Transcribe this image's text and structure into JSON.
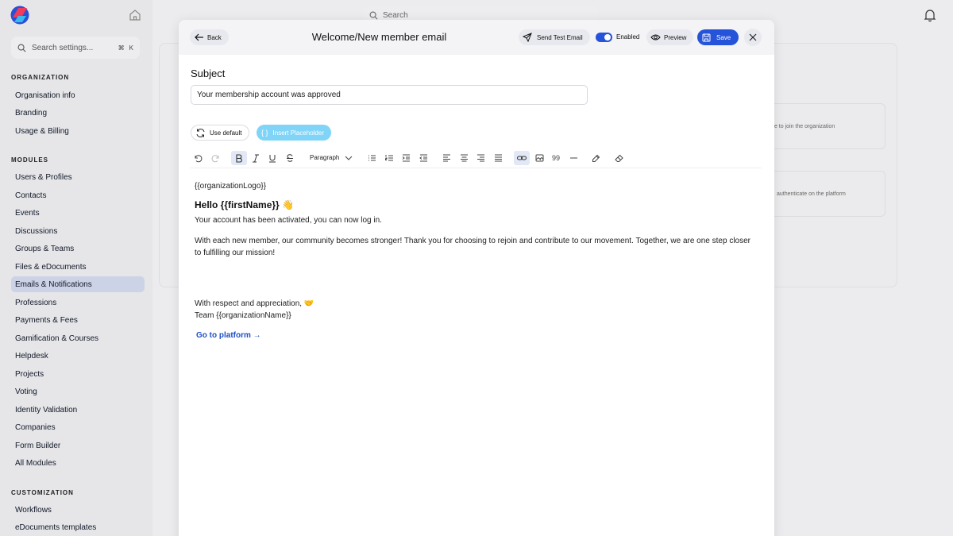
{
  "app": {
    "settings_search": {
      "placeholder": "Search settings...",
      "shortcut_cmd": "⌘",
      "shortcut_key": "K"
    },
    "topbar_search": {
      "placeholder": "Search"
    },
    "sidebar": {
      "sections": [
        {
          "title": "ORGANIZATION",
          "items": [
            "Organisation info",
            "Branding",
            "Usage & Billing"
          ]
        },
        {
          "title": "MODULES",
          "items": [
            "Users & Profiles",
            "Contacts",
            "Events",
            "Discussions",
            "Groups & Teams",
            "Files & eDocuments",
            "Emails & Notifications",
            "Professions",
            "Payments & Fees",
            "Gamification & Courses",
            "Helpdesk",
            "Projects",
            "Voting",
            "Identity Validation",
            "Companies",
            "Form Builder",
            "All Modules"
          ]
        },
        {
          "title": "CUSTOMIZATION",
          "items": [
            "Workflows",
            "eDocuments templates"
          ]
        }
      ],
      "active_item": "Emails & Notifications"
    },
    "background_cards": [
      "te to join the organization",
      "authenticate on the platform"
    ],
    "colors": {
      "primary": "#2553d9",
      "placeholder_button": "#7fd4f7",
      "active_nav": "#cdd3e6",
      "link": "#1f4fc4"
    }
  },
  "modal": {
    "back_label": "Back",
    "title": "Welcome/New member email",
    "send_test_label": "Send Test Email",
    "enabled_label": "Enabled",
    "enabled": true,
    "preview_label": "Preview",
    "save_label": "Save",
    "subject_label": "Subject",
    "subject_value": "Your membership account was approved",
    "use_default_label": "Use default",
    "insert_placeholder_label": "Insert Placeholder",
    "toolbar": {
      "paragraph_label": "Paragraph",
      "quote_label": "99"
    },
    "body": {
      "logo_placeholder": "{{organizationLogo}}",
      "greeting": "Hello {{firstName}} 👋",
      "line1": "Your account has been activated, you can now log in.",
      "paragraph": "With each new member, our community becomes stronger! Thank you for choosing to rejoin and contribute to our movement. Together, we are one step closer to fulfilling our mission!",
      "signoff": "With respect and appreciation, 🤝",
      "team": "Team {{organizationName}}",
      "cta": "Go to platform →"
    }
  }
}
